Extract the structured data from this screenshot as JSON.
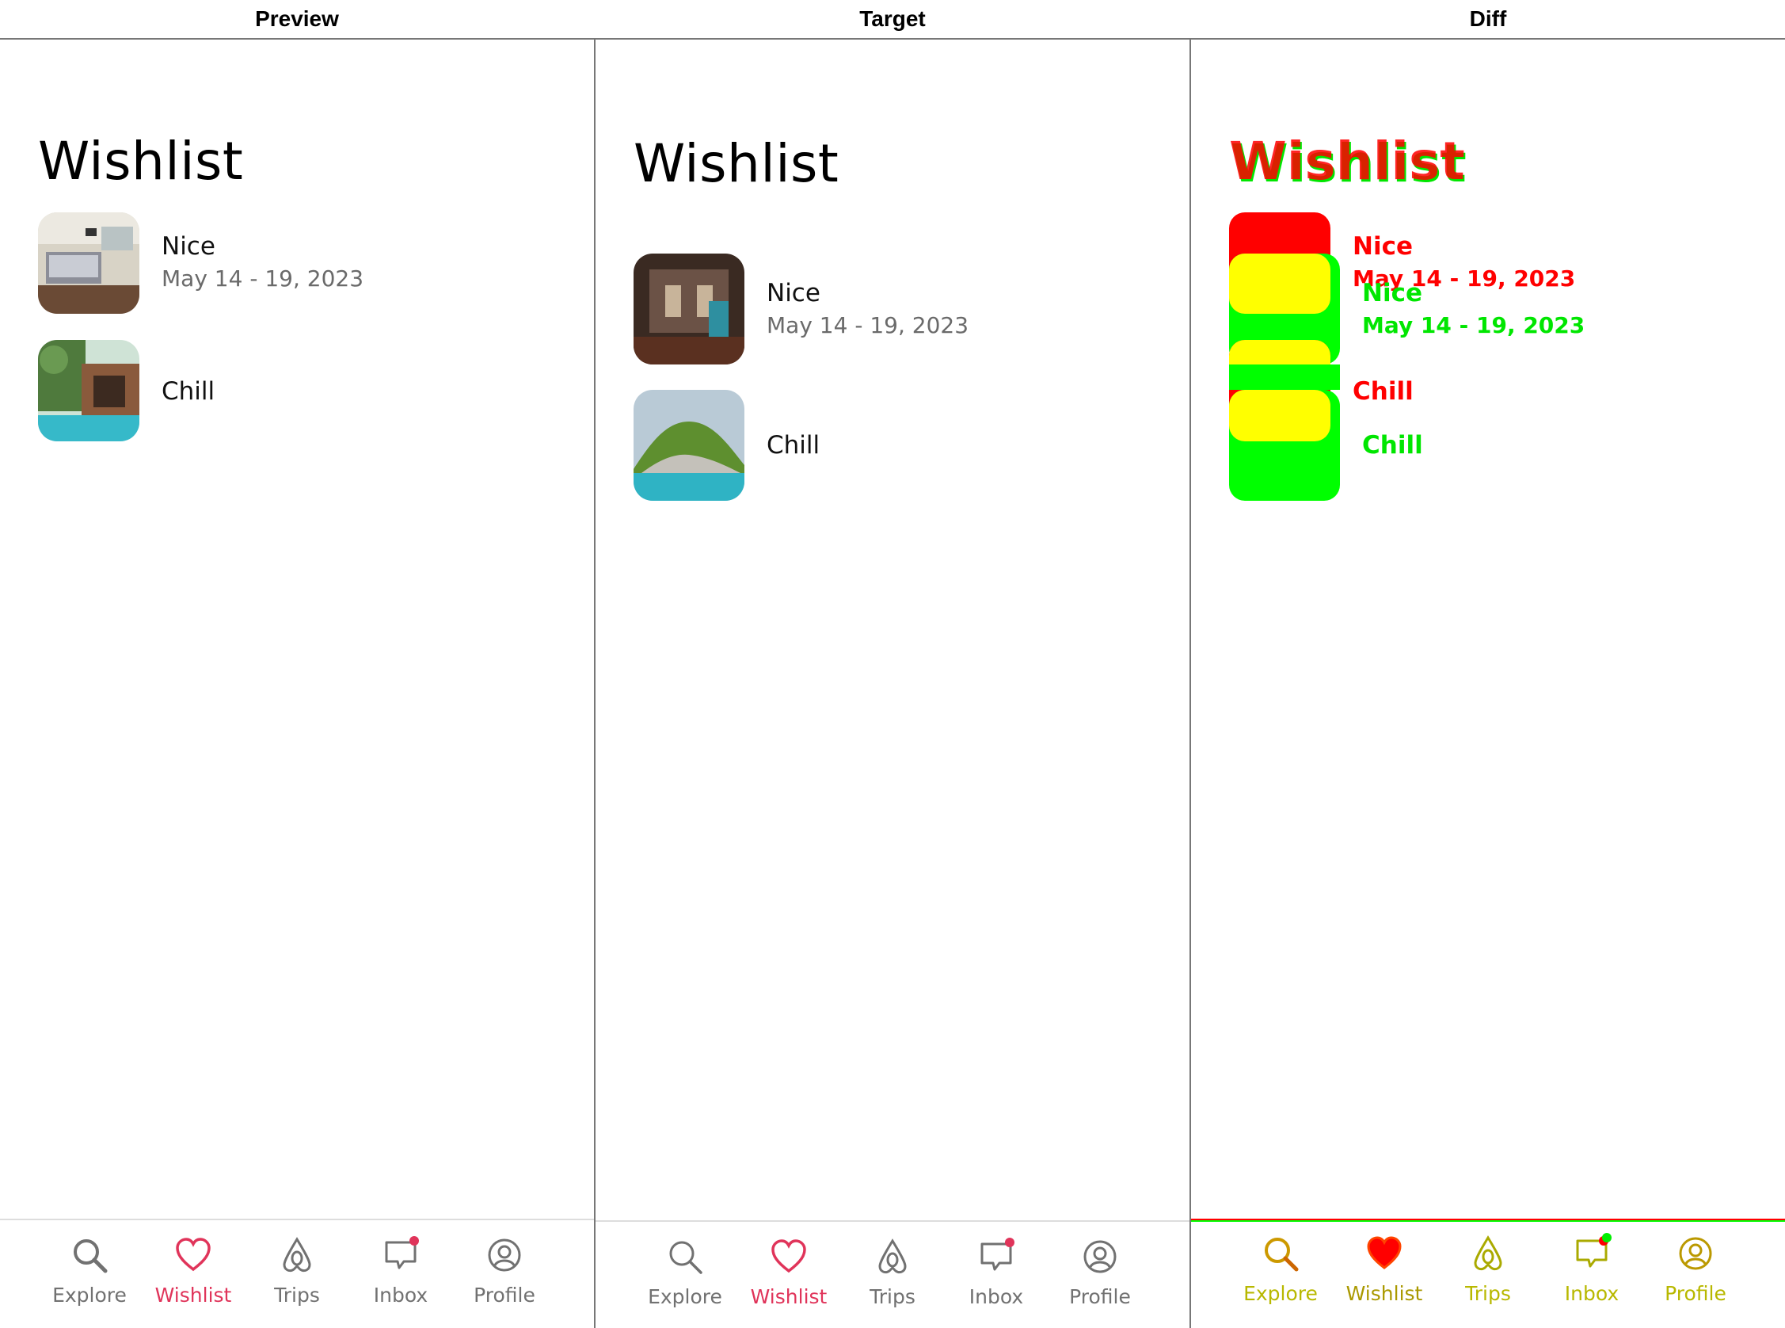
{
  "header": {
    "preview_label": "Preview",
    "target_label": "Target",
    "diff_label": "Diff"
  },
  "page": {
    "title": "Wishlist",
    "items": [
      {
        "name": "Nice",
        "date": "May 14 - 19, 2023"
      },
      {
        "name": "Chill",
        "date": ""
      }
    ]
  },
  "tabbar": {
    "tabs": [
      {
        "label": "Explore",
        "icon": "search-icon"
      },
      {
        "label": "Wishlist",
        "icon": "heart-icon",
        "active": true
      },
      {
        "label": "Trips",
        "icon": "airbnb-logo-icon"
      },
      {
        "label": "Inbox",
        "icon": "message-icon",
        "badge": true
      },
      {
        "label": "Profile",
        "icon": "user-circle-icon"
      }
    ]
  },
  "colors": {
    "accent": "#e0345a",
    "muted": "#717171",
    "diff_red": "#ff0000",
    "diff_green": "#00ff00",
    "diff_yellow": "#ffff00"
  }
}
